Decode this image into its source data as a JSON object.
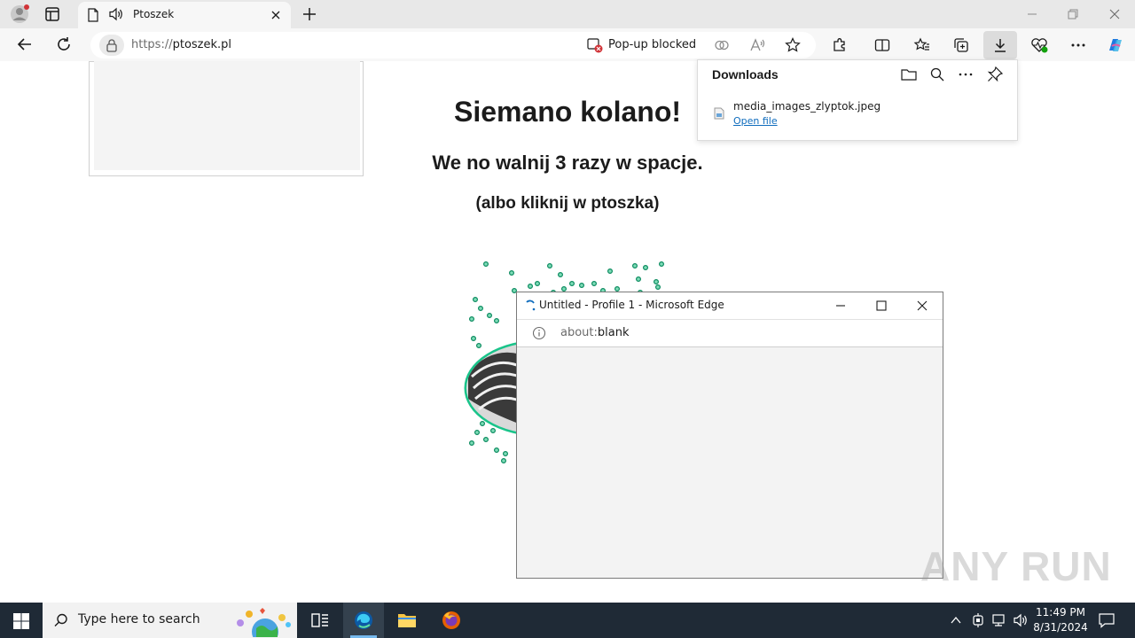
{
  "browser": {
    "tab": {
      "title": "Ptoszek"
    },
    "address": {
      "url_prefix": "https://",
      "url_host": "ptoszek.pl"
    },
    "popup_blocked_label": "Pop-up blocked"
  },
  "page": {
    "heading": "Siemano kolano!",
    "line1": "We no walnij 3 razy w spacje.",
    "line2": "(albo kliknij w ptoszka)"
  },
  "downloads": {
    "title": "Downloads",
    "file_name": "media_images_zlyptok.jpeg",
    "open_label": "Open file"
  },
  "popup_window": {
    "title": "Untitled - Profile 1 - Microsoft Edge",
    "url_prefix": "about:",
    "url_rest": "blank"
  },
  "watermark": "ANY RUN",
  "taskbar": {
    "search_placeholder": "Type here to search",
    "time": "11:49 PM",
    "date": "8/31/2024"
  },
  "colors": {
    "accent": "#0f6cbd",
    "taskbar": "#1f2a36",
    "confetti": "#0a8a5e"
  }
}
